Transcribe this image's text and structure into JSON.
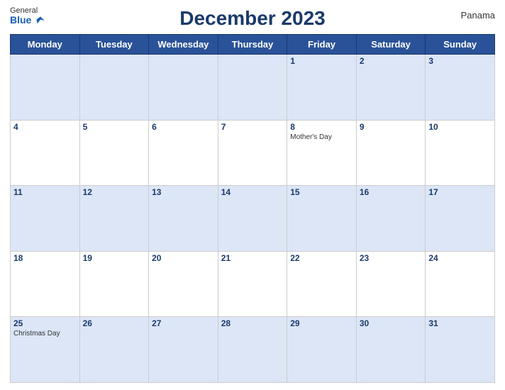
{
  "header": {
    "logo_general": "General",
    "logo_blue": "Blue",
    "title": "December 2023",
    "country": "Panama"
  },
  "days_of_week": [
    "Monday",
    "Tuesday",
    "Wednesday",
    "Thursday",
    "Friday",
    "Saturday",
    "Sunday"
  ],
  "weeks": [
    [
      {
        "num": "",
        "event": ""
      },
      {
        "num": "",
        "event": ""
      },
      {
        "num": "",
        "event": ""
      },
      {
        "num": "",
        "event": ""
      },
      {
        "num": "1",
        "event": ""
      },
      {
        "num": "2",
        "event": ""
      },
      {
        "num": "3",
        "event": ""
      }
    ],
    [
      {
        "num": "4",
        "event": ""
      },
      {
        "num": "5",
        "event": ""
      },
      {
        "num": "6",
        "event": ""
      },
      {
        "num": "7",
        "event": ""
      },
      {
        "num": "8",
        "event": "Mother's Day"
      },
      {
        "num": "9",
        "event": ""
      },
      {
        "num": "10",
        "event": ""
      }
    ],
    [
      {
        "num": "11",
        "event": ""
      },
      {
        "num": "12",
        "event": ""
      },
      {
        "num": "13",
        "event": ""
      },
      {
        "num": "14",
        "event": ""
      },
      {
        "num": "15",
        "event": ""
      },
      {
        "num": "16",
        "event": ""
      },
      {
        "num": "17",
        "event": ""
      }
    ],
    [
      {
        "num": "18",
        "event": ""
      },
      {
        "num": "19",
        "event": ""
      },
      {
        "num": "20",
        "event": ""
      },
      {
        "num": "21",
        "event": ""
      },
      {
        "num": "22",
        "event": ""
      },
      {
        "num": "23",
        "event": ""
      },
      {
        "num": "24",
        "event": ""
      }
    ],
    [
      {
        "num": "25",
        "event": "Christmas Day"
      },
      {
        "num": "26",
        "event": ""
      },
      {
        "num": "27",
        "event": ""
      },
      {
        "num": "28",
        "event": ""
      },
      {
        "num": "29",
        "event": ""
      },
      {
        "num": "30",
        "event": ""
      },
      {
        "num": "31",
        "event": ""
      }
    ]
  ]
}
